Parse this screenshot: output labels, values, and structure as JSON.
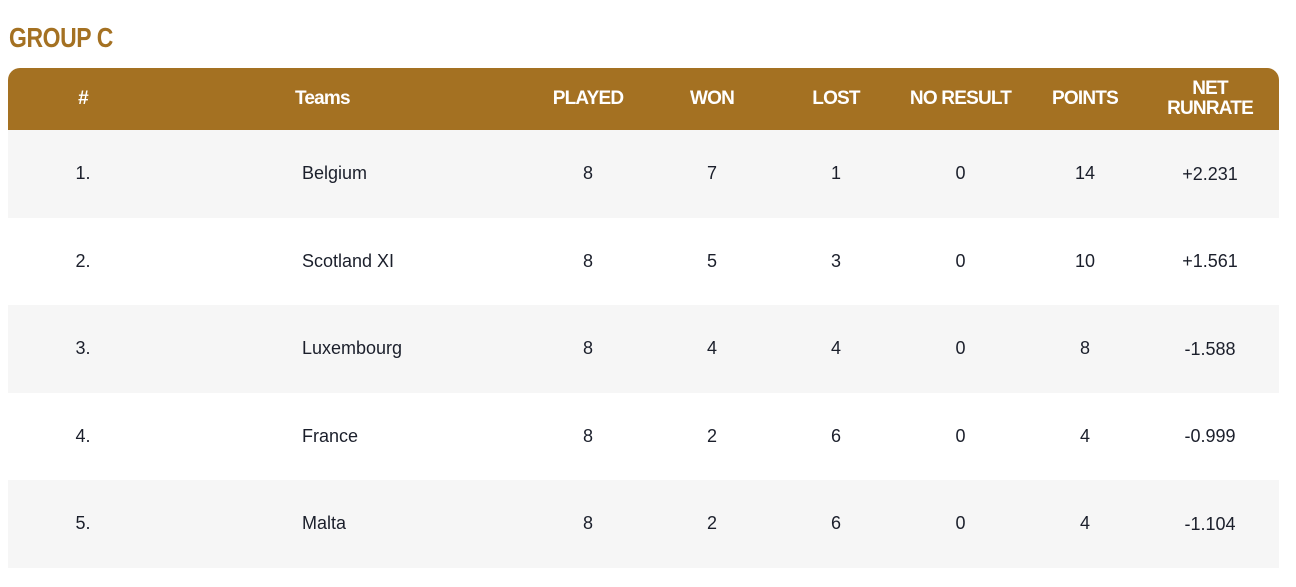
{
  "title": "GROUP C",
  "colors": {
    "accent": "#a47122",
    "row_alt": "#f6f6f6",
    "text": "#1b1f2b"
  },
  "headers": {
    "rank": "#",
    "team": "Teams",
    "played": "PLAYED",
    "won": "WON",
    "lost": "LOST",
    "no_result": "NO RESULT",
    "points": "POINTS",
    "nrr_line1": "NET",
    "nrr_line2": "RUNRATE"
  },
  "rows": [
    {
      "rank": "1.",
      "team": "Belgium",
      "played": "8",
      "won": "7",
      "lost": "1",
      "no_result": "0",
      "points": "14",
      "nrr": "+2.231"
    },
    {
      "rank": "2.",
      "team": "Scotland XI",
      "played": "8",
      "won": "5",
      "lost": "3",
      "no_result": "0",
      "points": "10",
      "nrr": "+1.561"
    },
    {
      "rank": "3.",
      "team": "Luxembourg",
      "played": "8",
      "won": "4",
      "lost": "4",
      "no_result": "0",
      "points": "8",
      "nrr": "-1.588"
    },
    {
      "rank": "4.",
      "team": "France",
      "played": "8",
      "won": "2",
      "lost": "6",
      "no_result": "0",
      "points": "4",
      "nrr": "-0.999"
    },
    {
      "rank": "5.",
      "team": "Malta",
      "played": "8",
      "won": "2",
      "lost": "6",
      "no_result": "0",
      "points": "4",
      "nrr": "-1.104"
    }
  ]
}
